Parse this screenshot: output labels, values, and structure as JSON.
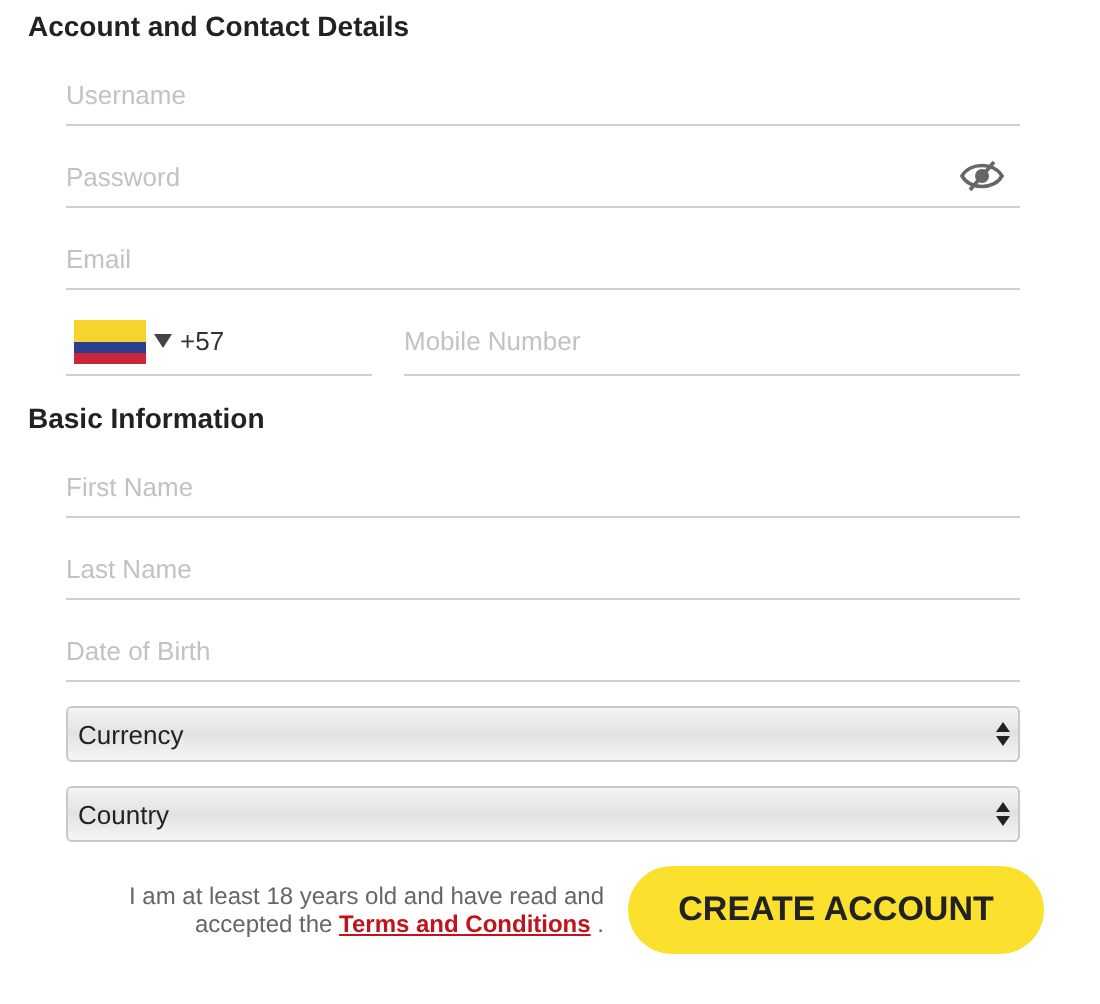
{
  "sections": [
    {
      "title": "Account and Contact Details",
      "fields": [
        {
          "kind": "text",
          "placeholder": "Username"
        },
        {
          "kind": "password",
          "placeholder": "Password",
          "visible": false
        },
        {
          "kind": "text",
          "placeholder": "Email"
        },
        {
          "kind": "phone",
          "code": "+57",
          "placeholder": "Mobile Number"
        }
      ]
    },
    {
      "title": "Basic Information",
      "fields": [
        {
          "kind": "text",
          "placeholder": "First Name"
        },
        {
          "kind": "text",
          "placeholder": "Last Name"
        },
        {
          "kind": "text",
          "placeholder": "Date of Birth"
        },
        {
          "kind": "select",
          "value": "Currency"
        },
        {
          "kind": "select",
          "value": "Country"
        }
      ]
    }
  ],
  "consent": {
    "text": "I am at least 18 years old and have read and accepted the ",
    "link": "Terms and Conditions",
    "after": " ."
  },
  "submit": "CREATE ACCOUNT"
}
